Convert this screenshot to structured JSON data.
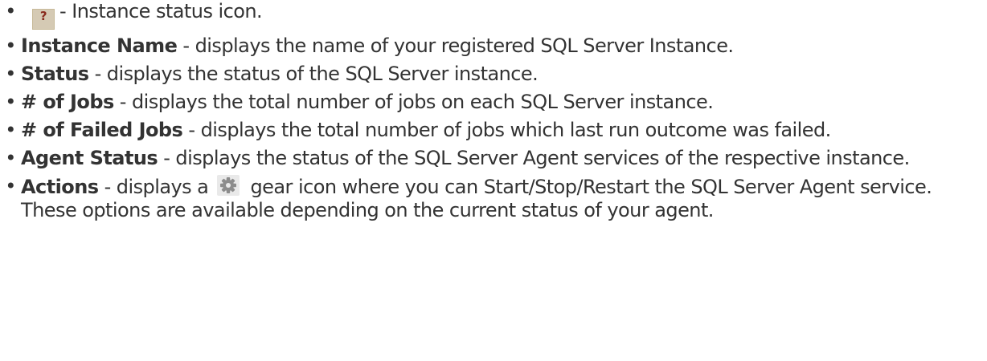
{
  "items": [
    {
      "term": "",
      "description": "- Instance status icon.",
      "icon": "question-status-icon",
      "icon_glyph": "?"
    },
    {
      "term": "Instance Name",
      "description": " - displays the name of your registered SQL Server Instance."
    },
    {
      "term": "Status",
      "description": " - displays the status of the SQL Server instance."
    },
    {
      "term": "# of Jobs",
      "description": " - displays the total number of jobs on each SQL Server instance."
    },
    {
      "term": "# of Failed Jobs",
      "description": " - displays the total number of jobs which last run outcome was failed."
    },
    {
      "term": "Agent Status",
      "description": " - displays the status of the SQL Server Agent services of the respective instance."
    },
    {
      "term": "Actions",
      "description_before": " - displays a ",
      "icon": "gear-icon",
      "description_after": " gear icon where you can Start/Stop/Restart the SQL Server Agent service. These options are available depending on the current status of your agent."
    }
  ],
  "bullet": "•",
  "colors": {
    "text": "#333333",
    "status_icon_bg": "#d5cab4",
    "status_icon_glyph": "#8a2b1e",
    "gear_icon": "#8c8c8c"
  }
}
